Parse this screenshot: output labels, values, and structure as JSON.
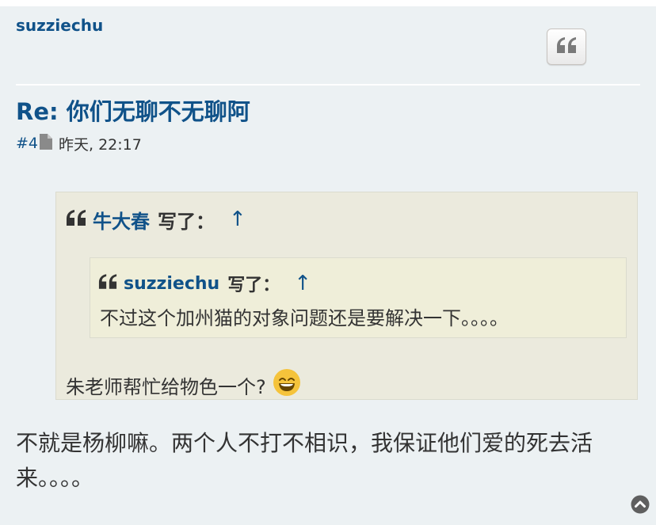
{
  "post": {
    "author": "suzziechu",
    "title": "Re: 你们无聊不无聊阿",
    "post_number": "#4",
    "timestamp": "昨天, 22:17",
    "quote_button_icon": "quote-icon",
    "body_line1": "不就是杨柳嘛。两个人不打不相识，我保证他们爱的死去活",
    "body_line2": "来。。。。",
    "back_to_top_icon": "chevron-up-circle-icon"
  },
  "quote_outer": {
    "author": "牛大春",
    "wrote_label": "写了：",
    "arrow": "↑",
    "text": "朱老师帮忙给物色一个?",
    "emoji": "grinning-face-icon"
  },
  "quote_inner": {
    "author": "suzziechu",
    "wrote_label": "写了：",
    "arrow": "↑",
    "text": "不过这个加州猫的对象问题还是要解决一下。。。。"
  },
  "colors": {
    "link": "#105289",
    "post_bg": "#ecf1f3",
    "quote_outer_bg": "#ebeadd",
    "quote_inner_bg": "#efeed9",
    "text": "#333333"
  }
}
